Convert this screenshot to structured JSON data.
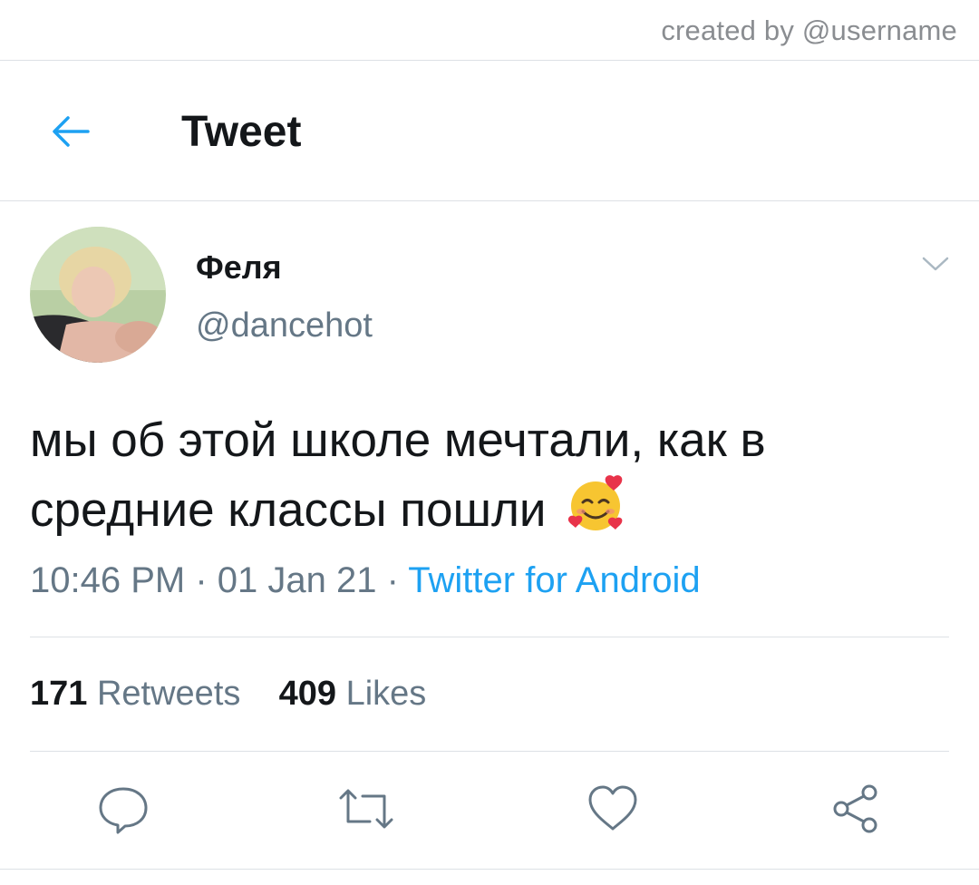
{
  "watermark": "created by @username",
  "header": {
    "title": "Tweet",
    "back_icon": "arrow-left-icon"
  },
  "tweet": {
    "author": {
      "display_name": "Феля",
      "handle": "@dancehot"
    },
    "text": "мы об этой школе мечтали, как в средние классы пошли",
    "emoji": "smiling-face-with-hearts",
    "time": "10:46 PM",
    "date": "01 Jan 21",
    "separator": " · ",
    "source": "Twitter for Android"
  },
  "stats": {
    "retweets_count": "171",
    "retweets_label": "Retweets",
    "likes_count": "409",
    "likes_label": "Likes"
  },
  "actions": [
    "reply-icon",
    "retweet-icon",
    "like-icon",
    "share-icon"
  ],
  "colors": {
    "accent": "#1da1f2",
    "text": "#14171a",
    "secondary": "#657786",
    "divider": "#dde1e5"
  }
}
